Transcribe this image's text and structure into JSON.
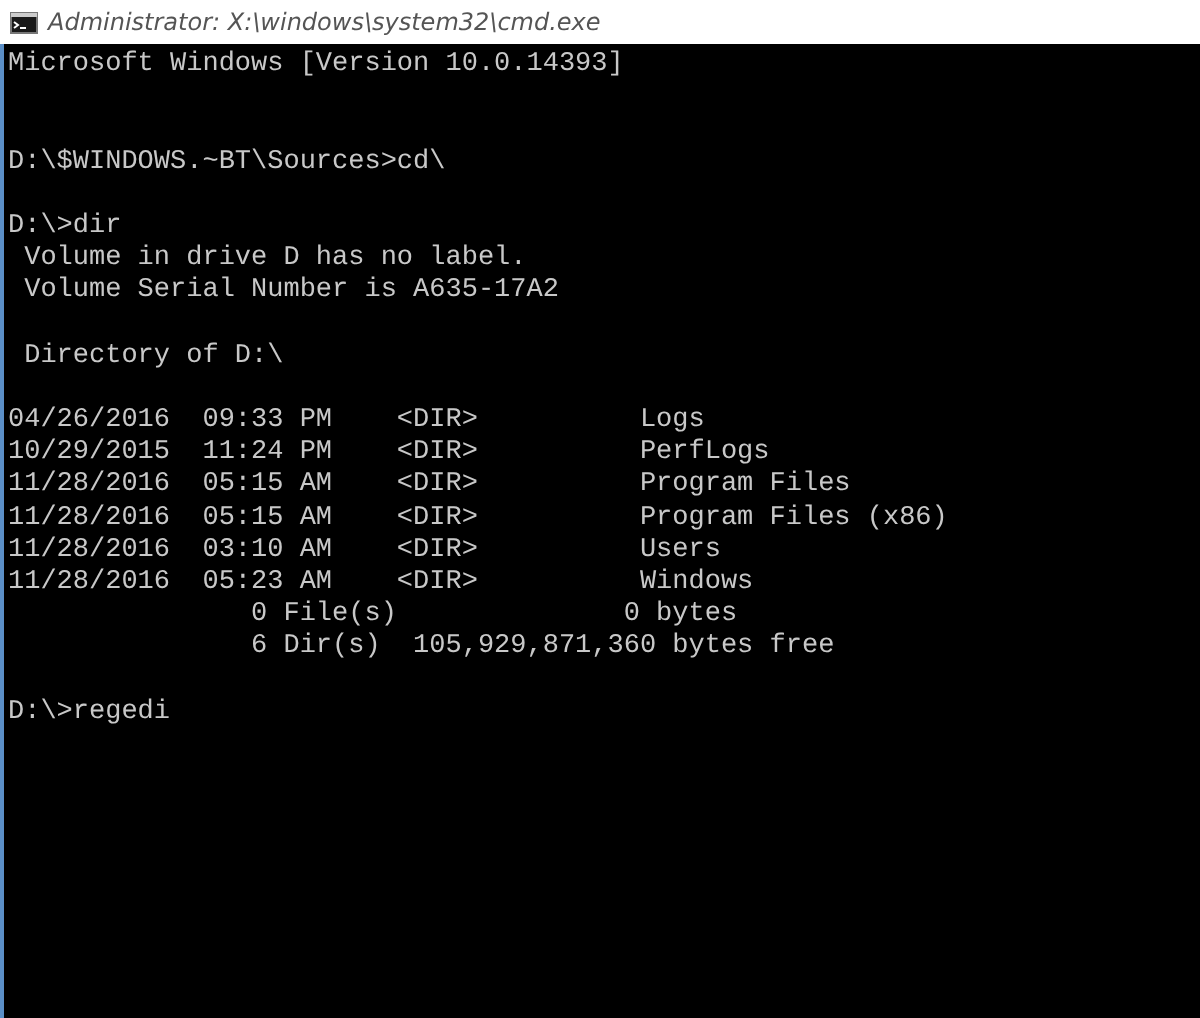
{
  "window": {
    "title": "Administrator: X:\\windows\\system32\\cmd.exe"
  },
  "console": {
    "lines": [
      {
        "kind": "text",
        "text": "Microsoft Windows [Version 10.0.14393]"
      },
      {
        "kind": "blank"
      },
      {
        "kind": "blank"
      },
      {
        "kind": "text",
        "text": "D:\\$WINDOWS.~BT\\Sources>cd\\"
      },
      {
        "kind": "blank"
      },
      {
        "kind": "text",
        "text": "D:\\>dir"
      },
      {
        "kind": "text",
        "text": " Volume in drive D has no label."
      },
      {
        "kind": "text",
        "text": " Volume Serial Number is A635-17A2"
      },
      {
        "kind": "blank"
      },
      {
        "kind": "text",
        "text": " Directory of D:\\"
      },
      {
        "kind": "blank"
      },
      {
        "kind": "text",
        "text": "04/26/2016  09:33 PM    <DIR>          Logs"
      },
      {
        "kind": "text",
        "text": "10/29/2015  11:24 PM    <DIR>          PerfLogs"
      },
      {
        "kind": "text",
        "text": "11/28/2016  05:15 AM    <DIR>          Program Files"
      },
      {
        "kind": "text",
        "text": "11/28/2016  05:15 AM    <DIR>          Program Files (x86)"
      },
      {
        "kind": "text",
        "text": "11/28/2016  03:10 AM    <DIR>          Users"
      },
      {
        "kind": "text",
        "text": "11/28/2016  05:23 AM    <DIR>          Windows"
      },
      {
        "kind": "text",
        "text": "               0 File(s)              0 bytes"
      },
      {
        "kind": "text",
        "text": "               6 Dir(s)  105,929,871,360 bytes free"
      },
      {
        "kind": "blank"
      },
      {
        "kind": "text",
        "text": "D:\\>regedi"
      }
    ]
  }
}
